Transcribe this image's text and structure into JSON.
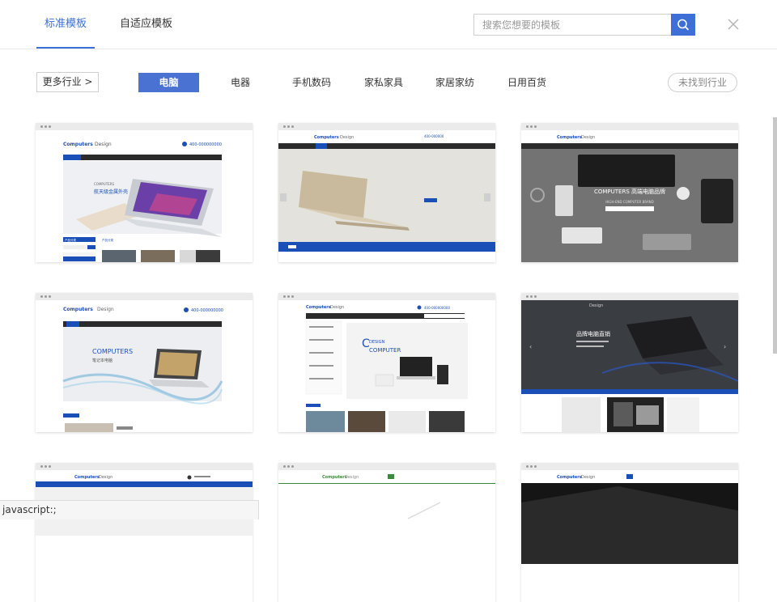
{
  "tabs": [
    {
      "label": "标准模板",
      "active": true
    },
    {
      "label": "自适应模板",
      "active": false
    }
  ],
  "search": {
    "placeholder": "搜索您想要的模板",
    "icon": "search-icon"
  },
  "close_icon": "close-icon",
  "filters": {
    "more_label": "更多行业 >",
    "categories": [
      "电脑",
      "电器",
      "手机数码",
      "家私家具",
      "家居家纺",
      "日用百货"
    ],
    "active_category": "电脑",
    "not_found_label": "未找到行业"
  },
  "templates": {
    "t1": {
      "brand": "Computers",
      "brand2": "Design",
      "phone": "400-000000000",
      "headline": "航天级金属外壳",
      "kicker": "COMPUTERS",
      "section": "产品分类"
    },
    "t2": {
      "brand": "Computers",
      "brand2": "Design",
      "phone": "400-000000"
    },
    "t3": {
      "brand": "Computers",
      "brand2": "Design",
      "headline": "COMPUTERS 高端电脑品牌",
      "sub": "HIGH-END COMPUTER BRAND"
    },
    "t4": {
      "brand": "Computers",
      "brand2": "Design",
      "phone": "400-000000000",
      "headline": "COMPUTERS",
      "sub": "笔记本电脑"
    },
    "t5": {
      "brand": "Computers",
      "brand2": "Design",
      "phone": "400-000000000",
      "headline1": "DESIGN",
      "headline2": "COMPUTER"
    },
    "t6": {
      "brand2": "Design",
      "headline": "品牌电脑直销"
    },
    "t7": {
      "brand": "Computers",
      "brand2": "Design"
    },
    "t8": {
      "brand": "Computers",
      "brand2": "Design"
    },
    "t9": {
      "brand": "Computers",
      "brand2": "Design"
    }
  },
  "status_bar": "javascript:;",
  "colors": {
    "accent": "#3d6fd6",
    "site_blue": "#1a4fb8",
    "dark_nav": "#2b2b2b"
  }
}
